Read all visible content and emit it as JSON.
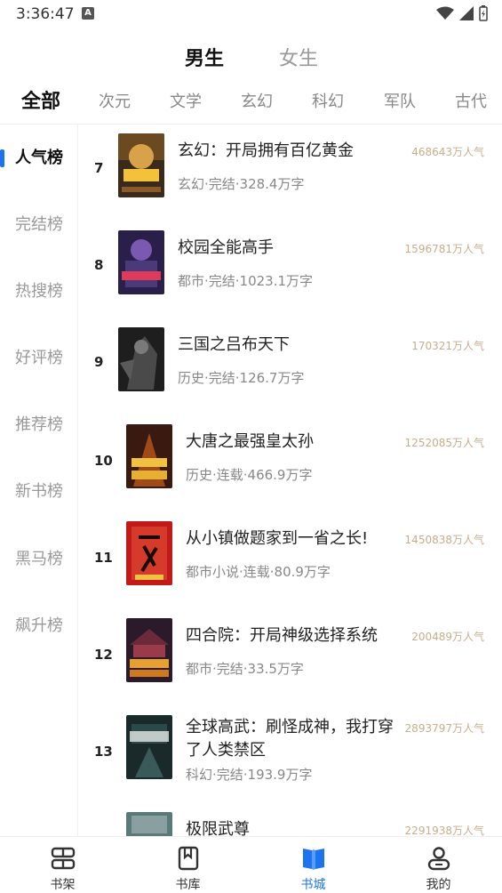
{
  "status": {
    "time": "3:36:47",
    "a_icon": "A"
  },
  "gender_tabs": [
    {
      "label": "男生",
      "active": true
    },
    {
      "label": "女生",
      "active": false
    }
  ],
  "categories": [
    "全部",
    "次元",
    "文学",
    "玄幻",
    "科幻",
    "军队",
    "古代"
  ],
  "sidebar": [
    "人气榜",
    "完结榜",
    "热搜榜",
    "好评榜",
    "推荐榜",
    "新书榜",
    "黑马榜",
    "飙升榜"
  ],
  "books": [
    {
      "rank": "7",
      "title": "玄幻：开局拥有百亿黄金",
      "meta": "玄幻·完结·328.4万字",
      "pop": "468643万人气",
      "cover": "cover-gold"
    },
    {
      "rank": "8",
      "title": "校园全能高手",
      "meta": "都市·完结·1023.1万字",
      "pop": "1596781万人气",
      "cover": "cover-campus"
    },
    {
      "rank": "9",
      "title": "三国之吕布天下",
      "meta": "历史·完结·126.7万字",
      "pop": "170321万人气",
      "cover": "cover-lvbu"
    },
    {
      "rank": "10",
      "title": "大唐之最强皇太孙",
      "meta": "历史·连载·466.9万字",
      "pop": "1252085万人气",
      "cover": "cover-tang"
    },
    {
      "rank": "11",
      "title": "从小镇做题家到一省之长!",
      "meta": "都市小说·连载·80.9万字",
      "pop": "1450838万人气",
      "cover": "cover-town"
    },
    {
      "rank": "12",
      "title": "四合院：开局神级选择系统",
      "meta": "都市·完结·33.5万字",
      "pop": "200489万人气",
      "cover": "cover-siheyuan"
    },
    {
      "rank": "13",
      "title_line1": "全球高武：刷怪成神，我打穿",
      "title_line2": "了人类禁区",
      "meta": "科幻·完结·193.9万字",
      "pop": "2893797万人气",
      "cover": "cover-global"
    },
    {
      "rank": "",
      "title": "极限武尊",
      "meta": "",
      "pop": "2291938万人气",
      "cover": "cover-wuzun"
    }
  ],
  "bottom_nav": [
    {
      "label": "书架",
      "icon": "bookshelf-icon"
    },
    {
      "label": "书库",
      "icon": "library-icon"
    },
    {
      "label": "书城",
      "icon": "bookstore-icon",
      "active": true
    },
    {
      "label": "我的",
      "icon": "profile-icon"
    }
  ],
  "colors": {
    "accent": "#1e73f0",
    "popularity": "#c9ad8a",
    "muted": "#888888"
  }
}
